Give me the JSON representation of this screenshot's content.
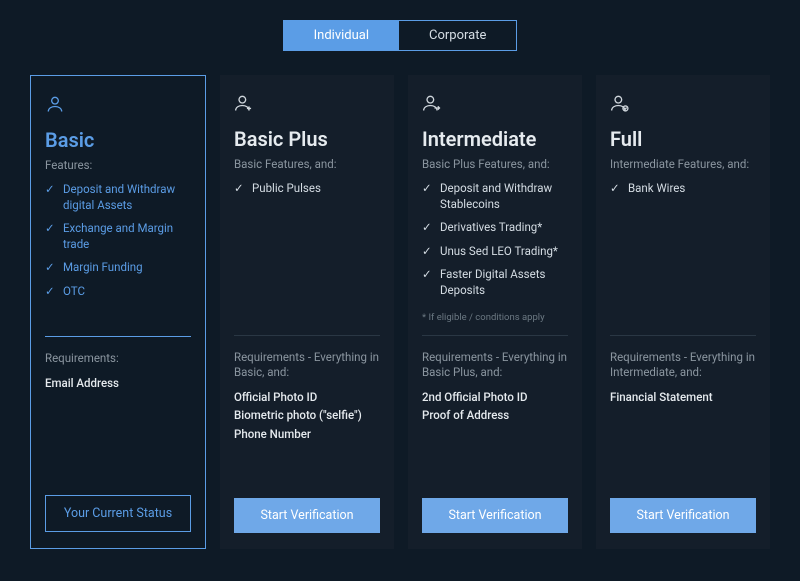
{
  "tabs": {
    "individual": "Individual",
    "corporate": "Corporate"
  },
  "tiers": [
    {
      "title": "Basic",
      "sub": "Features:",
      "features": [
        "Deposit and Withdraw digital Assets",
        "Exchange and Margin trade",
        "Margin Funding",
        "OTC"
      ],
      "footnote": "",
      "req_title": "Requirements:",
      "requirements": [
        "Email Address"
      ],
      "cta": "Your Current Status"
    },
    {
      "title": "Basic Plus",
      "sub": "Basic Features, and:",
      "features": [
        "Public Pulses"
      ],
      "footnote": "",
      "req_title": "Requirements - Everything in Basic, and:",
      "requirements": [
        "Official Photo ID",
        "Biometric photo (\"selfie\")",
        "Phone Number"
      ],
      "cta": "Start Verification"
    },
    {
      "title": "Intermediate",
      "sub": "Basic Plus Features, and:",
      "features": [
        "Deposit and Withdraw Stablecoins",
        "Derivatives Trading*",
        "Unus Sed LEO Trading*",
        "Faster Digital Assets Deposits"
      ],
      "footnote": "* If eligible / conditions apply",
      "req_title": "Requirements - Everything in Basic Plus, and:",
      "requirements": [
        "2nd Official Photo ID",
        "Proof of Address"
      ],
      "cta": "Start Verification"
    },
    {
      "title": "Full",
      "sub": "Intermediate Features, and:",
      "features": [
        "Bank Wires"
      ],
      "footnote": "",
      "req_title": "Requirements - Everything in Intermediate, and:",
      "requirements": [
        "Financial Statement"
      ],
      "cta": "Start Verification"
    }
  ]
}
